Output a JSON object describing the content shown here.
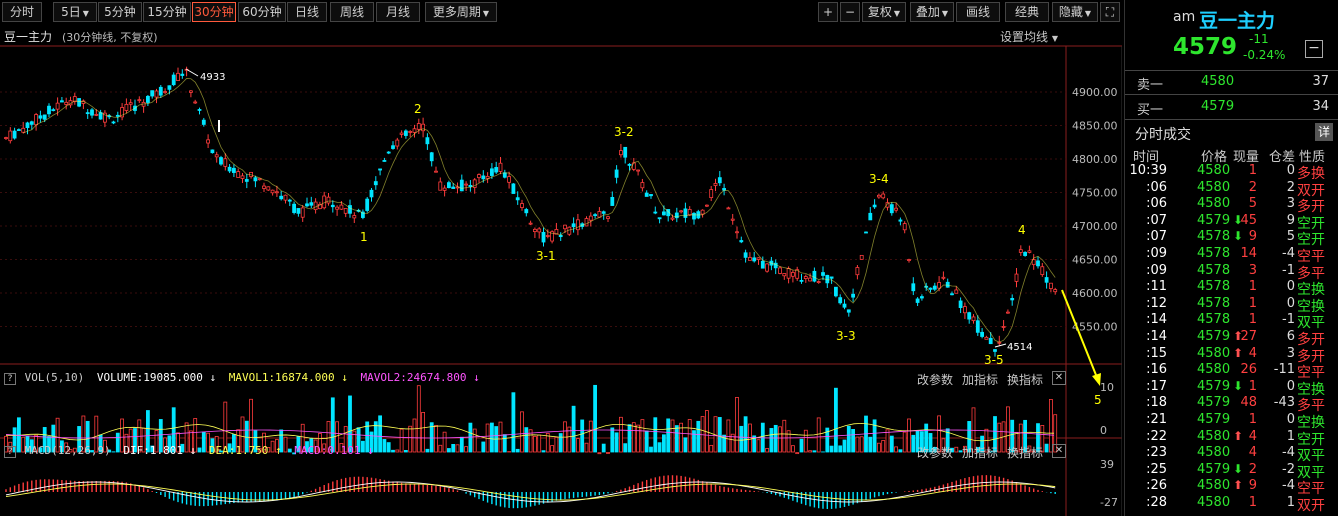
{
  "toolbar": {
    "periods": [
      {
        "label": "分时",
        "active": false
      },
      {
        "label": "5日",
        "active": false,
        "dropdown": true
      },
      {
        "label": "5分钟",
        "active": false
      },
      {
        "label": "15分钟",
        "active": false
      },
      {
        "label": "30分钟",
        "active": true
      },
      {
        "label": "60分钟",
        "active": false
      },
      {
        "label": "日线",
        "active": false
      },
      {
        "label": "周线",
        "active": false
      },
      {
        "label": "月线",
        "active": false
      },
      {
        "label": "更多周期",
        "active": false,
        "dropdown": true
      }
    ],
    "right_buttons": [
      {
        "label": "+"
      },
      {
        "label": "−"
      },
      {
        "label": "复权",
        "dropdown": true
      },
      {
        "label": "叠加",
        "dropdown": true
      },
      {
        "label": "画线"
      },
      {
        "label": "经典"
      },
      {
        "label": "隐藏",
        "dropdown": true
      }
    ]
  },
  "chart": {
    "title": "豆一主力",
    "subtitle": "(30分钟线, 不复权)",
    "set_ma": "设置均线",
    "price_axis": [
      "4900.00",
      "4850.00",
      "4800.00",
      "4750.00",
      "4700.00",
      "4650.00",
      "4600.00",
      "4550.00"
    ],
    "annotations": {
      "high": "4933",
      "low": "4514",
      "waves": [
        "1",
        "2",
        "3-1",
        "3-2",
        "3-3",
        "3-4",
        "3-5",
        "4",
        "5"
      ]
    },
    "vol": {
      "name": "VOL(5,10)",
      "volume": "VOLUME:19085.000",
      "mavol1": "MAVOL1:16874.000",
      "mavol2": "MAVOL2:24674.800",
      "axis": [
        "10",
        "0"
      ],
      "btn_params": "改参数",
      "btn_add": "加指标",
      "btn_switch": "换指标"
    },
    "macd": {
      "name": "MACD(12,26,9)",
      "dif": "DIF:1.801",
      "dea": "DEA:1.750",
      "macd": "MACD:0.101",
      "axis": [
        "39",
        "-27"
      ],
      "btn_params": "改参数",
      "btn_add": "加指标",
      "btn_switch": "换指标"
    },
    "colors": {
      "up": "#ff3c3c",
      "down": "#00e5ff",
      "ma": "#ffff55",
      "mavol2": "#ff55ff",
      "annot": "#ffff00"
    }
  },
  "panel": {
    "prefix": "am",
    "name": "豆一主力",
    "price": "4579",
    "change": "-11",
    "change_pct": "-0.24%",
    "sell_label": "卖一",
    "sell_price": "4580",
    "sell_qty": "37",
    "buy_label": "买一",
    "buy_price": "4579",
    "buy_qty": "34",
    "ticks_title": "分时成交",
    "detail_btn": "详",
    "headers": [
      "时间",
      "价格",
      "现量",
      "仓差",
      "性质"
    ],
    "ticks": [
      {
        "time": "10:39",
        "price": "4580",
        "arrow": "",
        "vol": "1",
        "oi": "0",
        "type": "多换"
      },
      {
        "time": ":06",
        "price": "4580",
        "arrow": "",
        "vol": "2",
        "oi": "2",
        "type": "双开"
      },
      {
        "time": ":06",
        "price": "4580",
        "arrow": "",
        "vol": "5",
        "oi": "3",
        "type": "多开"
      },
      {
        "time": ":07",
        "price": "4579",
        "arrow": "down",
        "vol": "45",
        "oi": "9",
        "type": "空开"
      },
      {
        "time": ":07",
        "price": "4578",
        "arrow": "down",
        "vol": "9",
        "oi": "5",
        "type": "空开"
      },
      {
        "time": ":09",
        "price": "4578",
        "arrow": "",
        "vol": "14",
        "oi": "-4",
        "type": "空平"
      },
      {
        "time": ":09",
        "price": "4578",
        "arrow": "",
        "vol": "3",
        "oi": "-1",
        "type": "多平"
      },
      {
        "time": ":11",
        "price": "4578",
        "arrow": "",
        "vol": "1",
        "oi": "0",
        "type": "空换"
      },
      {
        "time": ":12",
        "price": "4578",
        "arrow": "",
        "vol": "1",
        "oi": "0",
        "type": "空换"
      },
      {
        "time": ":14",
        "price": "4578",
        "arrow": "",
        "vol": "1",
        "oi": "-1",
        "type": "双平"
      },
      {
        "time": ":14",
        "price": "4579",
        "arrow": "up",
        "vol": "27",
        "oi": "6",
        "type": "多开"
      },
      {
        "time": ":15",
        "price": "4580",
        "arrow": "up",
        "vol": "4",
        "oi": "3",
        "type": "多开"
      },
      {
        "time": ":16",
        "price": "4580",
        "arrow": "",
        "vol": "26",
        "oi": "-11",
        "type": "空平"
      },
      {
        "time": ":17",
        "price": "4579",
        "arrow": "down",
        "vol": "1",
        "oi": "0",
        "type": "空换"
      },
      {
        "time": ":18",
        "price": "4579",
        "arrow": "",
        "vol": "48",
        "oi": "-43",
        "type": "多平"
      },
      {
        "time": ":21",
        "price": "4579",
        "arrow": "",
        "vol": "1",
        "oi": "0",
        "type": "空换"
      },
      {
        "time": ":22",
        "price": "4580",
        "arrow": "up",
        "vol": "4",
        "oi": "1",
        "type": "空开"
      },
      {
        "time": ":23",
        "price": "4580",
        "arrow": "",
        "vol": "4",
        "oi": "-4",
        "type": "双平"
      },
      {
        "time": ":25",
        "price": "4579",
        "arrow": "down",
        "vol": "2",
        "oi": "-2",
        "type": "双平"
      },
      {
        "time": ":26",
        "price": "4580",
        "arrow": "up",
        "vol": "9",
        "oi": "-4",
        "type": "空平"
      },
      {
        "time": ":28",
        "price": "4580",
        "arrow": "",
        "vol": "1",
        "oi": "1",
        "type": "双开"
      }
    ]
  }
}
